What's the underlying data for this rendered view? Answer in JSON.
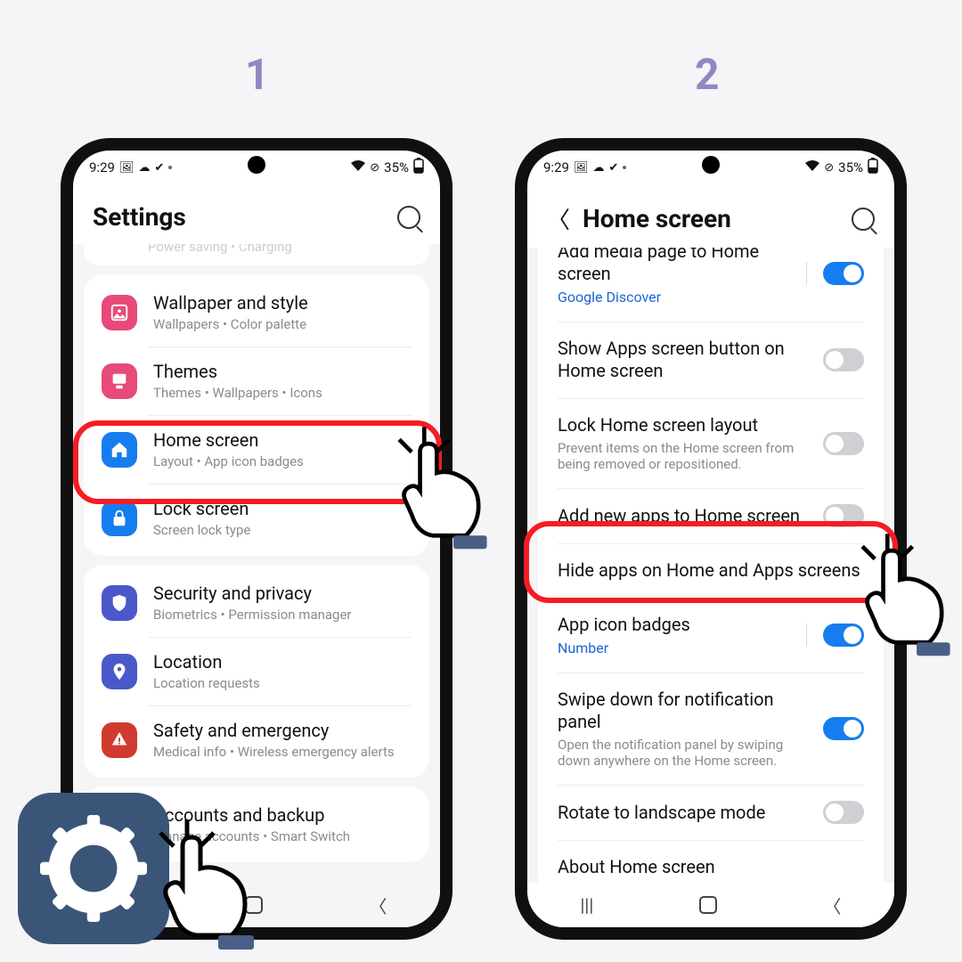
{
  "steps": {
    "one": "1",
    "two": "2"
  },
  "statusbar": {
    "time": "9:29",
    "battery": "35%"
  },
  "screen1": {
    "title": "Settings",
    "truncated": "Power saving  •  Charging",
    "groups": [
      [
        {
          "title": "Wallpaper and style",
          "sub": "Wallpapers  •  Color palette",
          "icon": "wallpaper",
          "color": "#e84a7a"
        },
        {
          "title": "Themes",
          "sub": "Themes  •  Wallpapers  •  Icons",
          "icon": "themes",
          "color": "#e84a7a"
        },
        {
          "title": "Home screen",
          "sub": "Layout  •  App icon badges",
          "icon": "home",
          "color": "#167df0"
        },
        {
          "title": "Lock screen",
          "sub": "Screen lock type",
          "icon": "lock",
          "color": "#167df0"
        }
      ],
      [
        {
          "title": "Security and privacy",
          "sub": "Biometrics  •  Permission manager",
          "icon": "shield",
          "color": "#4b58c9"
        },
        {
          "title": "Location",
          "sub": "Location requests",
          "icon": "location",
          "color": "#4b58c9"
        },
        {
          "title": "Safety and emergency",
          "sub": "Medical info  •  Wireless emergency alerts",
          "icon": "safety",
          "color": "#d13a2f"
        }
      ],
      [
        {
          "title": "Accounts and backup",
          "sub": "Manage accounts  •  Smart Switch",
          "icon": "accounts",
          "color": "#3a3f4b"
        }
      ]
    ]
  },
  "screen2": {
    "title": "Home screen",
    "options": [
      {
        "title": "Add media page to Home screen",
        "link": "Google Discover",
        "toggle": "on",
        "vbar": true
      },
      {
        "title": "Show Apps screen button on Home screen",
        "toggle": "off"
      },
      {
        "title": "Lock Home screen layout",
        "sub": "Prevent items on the Home screen from being removed or repositioned.",
        "toggle": "off"
      },
      {
        "title": "Add new apps to Home screen",
        "toggle": "off"
      },
      {
        "title": "Hide apps on Home and Apps screens"
      },
      {
        "title": "App icon badges",
        "link": "Number",
        "toggle": "on",
        "vbar": true
      },
      {
        "title": "Swipe down for notification panel",
        "sub": "Open the notification panel by swiping down anywhere on the Home screen.",
        "toggle": "on"
      },
      {
        "title": "Rotate to landscape mode",
        "toggle": "off"
      },
      {
        "title": "About Home screen"
      }
    ]
  }
}
